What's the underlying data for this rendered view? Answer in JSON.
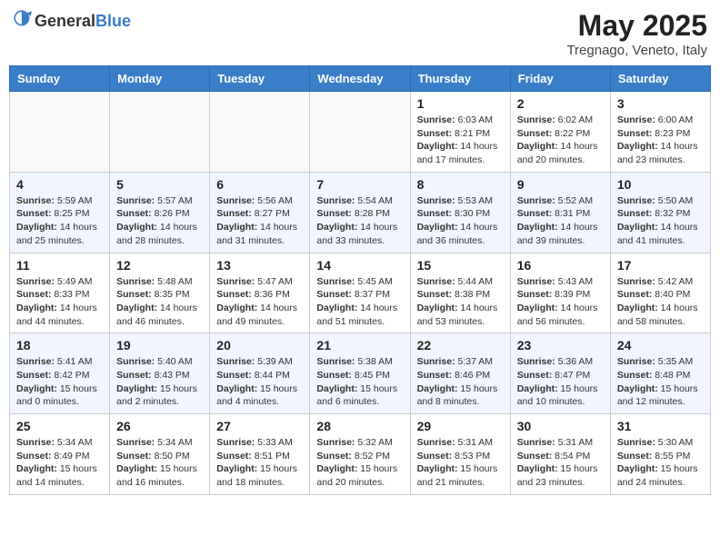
{
  "header": {
    "logo_general": "General",
    "logo_blue": "Blue",
    "month": "May 2025",
    "location": "Tregnago, Veneto, Italy"
  },
  "days_of_week": [
    "Sunday",
    "Monday",
    "Tuesday",
    "Wednesday",
    "Thursday",
    "Friday",
    "Saturday"
  ],
  "weeks": [
    [
      {
        "day": "",
        "empty": true
      },
      {
        "day": "",
        "empty": true
      },
      {
        "day": "",
        "empty": true
      },
      {
        "day": "",
        "empty": true
      },
      {
        "day": "1",
        "sunrise": "6:03 AM",
        "sunset": "8:21 PM",
        "daylight": "14 hours and 17 minutes."
      },
      {
        "day": "2",
        "sunrise": "6:02 AM",
        "sunset": "8:22 PM",
        "daylight": "14 hours and 20 minutes."
      },
      {
        "day": "3",
        "sunrise": "6:00 AM",
        "sunset": "8:23 PM",
        "daylight": "14 hours and 23 minutes."
      }
    ],
    [
      {
        "day": "4",
        "sunrise": "5:59 AM",
        "sunset": "8:25 PM",
        "daylight": "14 hours and 25 minutes."
      },
      {
        "day": "5",
        "sunrise": "5:57 AM",
        "sunset": "8:26 PM",
        "daylight": "14 hours and 28 minutes."
      },
      {
        "day": "6",
        "sunrise": "5:56 AM",
        "sunset": "8:27 PM",
        "daylight": "14 hours and 31 minutes."
      },
      {
        "day": "7",
        "sunrise": "5:54 AM",
        "sunset": "8:28 PM",
        "daylight": "14 hours and 33 minutes."
      },
      {
        "day": "8",
        "sunrise": "5:53 AM",
        "sunset": "8:30 PM",
        "daylight": "14 hours and 36 minutes."
      },
      {
        "day": "9",
        "sunrise": "5:52 AM",
        "sunset": "8:31 PM",
        "daylight": "14 hours and 39 minutes."
      },
      {
        "day": "10",
        "sunrise": "5:50 AM",
        "sunset": "8:32 PM",
        "daylight": "14 hours and 41 minutes."
      }
    ],
    [
      {
        "day": "11",
        "sunrise": "5:49 AM",
        "sunset": "8:33 PM",
        "daylight": "14 hours and 44 minutes."
      },
      {
        "day": "12",
        "sunrise": "5:48 AM",
        "sunset": "8:35 PM",
        "daylight": "14 hours and 46 minutes."
      },
      {
        "day": "13",
        "sunrise": "5:47 AM",
        "sunset": "8:36 PM",
        "daylight": "14 hours and 49 minutes."
      },
      {
        "day": "14",
        "sunrise": "5:45 AM",
        "sunset": "8:37 PM",
        "daylight": "14 hours and 51 minutes."
      },
      {
        "day": "15",
        "sunrise": "5:44 AM",
        "sunset": "8:38 PM",
        "daylight": "14 hours and 53 minutes."
      },
      {
        "day": "16",
        "sunrise": "5:43 AM",
        "sunset": "8:39 PM",
        "daylight": "14 hours and 56 minutes."
      },
      {
        "day": "17",
        "sunrise": "5:42 AM",
        "sunset": "8:40 PM",
        "daylight": "14 hours and 58 minutes."
      }
    ],
    [
      {
        "day": "18",
        "sunrise": "5:41 AM",
        "sunset": "8:42 PM",
        "daylight": "15 hours and 0 minutes."
      },
      {
        "day": "19",
        "sunrise": "5:40 AM",
        "sunset": "8:43 PM",
        "daylight": "15 hours and 2 minutes."
      },
      {
        "day": "20",
        "sunrise": "5:39 AM",
        "sunset": "8:44 PM",
        "daylight": "15 hours and 4 minutes."
      },
      {
        "day": "21",
        "sunrise": "5:38 AM",
        "sunset": "8:45 PM",
        "daylight": "15 hours and 6 minutes."
      },
      {
        "day": "22",
        "sunrise": "5:37 AM",
        "sunset": "8:46 PM",
        "daylight": "15 hours and 8 minutes."
      },
      {
        "day": "23",
        "sunrise": "5:36 AM",
        "sunset": "8:47 PM",
        "daylight": "15 hours and 10 minutes."
      },
      {
        "day": "24",
        "sunrise": "5:35 AM",
        "sunset": "8:48 PM",
        "daylight": "15 hours and 12 minutes."
      }
    ],
    [
      {
        "day": "25",
        "sunrise": "5:34 AM",
        "sunset": "8:49 PM",
        "daylight": "15 hours and 14 minutes."
      },
      {
        "day": "26",
        "sunrise": "5:34 AM",
        "sunset": "8:50 PM",
        "daylight": "15 hours and 16 minutes."
      },
      {
        "day": "27",
        "sunrise": "5:33 AM",
        "sunset": "8:51 PM",
        "daylight": "15 hours and 18 minutes."
      },
      {
        "day": "28",
        "sunrise": "5:32 AM",
        "sunset": "8:52 PM",
        "daylight": "15 hours and 20 minutes."
      },
      {
        "day": "29",
        "sunrise": "5:31 AM",
        "sunset": "8:53 PM",
        "daylight": "15 hours and 21 minutes."
      },
      {
        "day": "30",
        "sunrise": "5:31 AM",
        "sunset": "8:54 PM",
        "daylight": "15 hours and 23 minutes."
      },
      {
        "day": "31",
        "sunrise": "5:30 AM",
        "sunset": "8:55 PM",
        "daylight": "15 hours and 24 minutes."
      }
    ]
  ],
  "labels": {
    "sunrise": "Sunrise:",
    "sunset": "Sunset:",
    "daylight": "Daylight:"
  }
}
